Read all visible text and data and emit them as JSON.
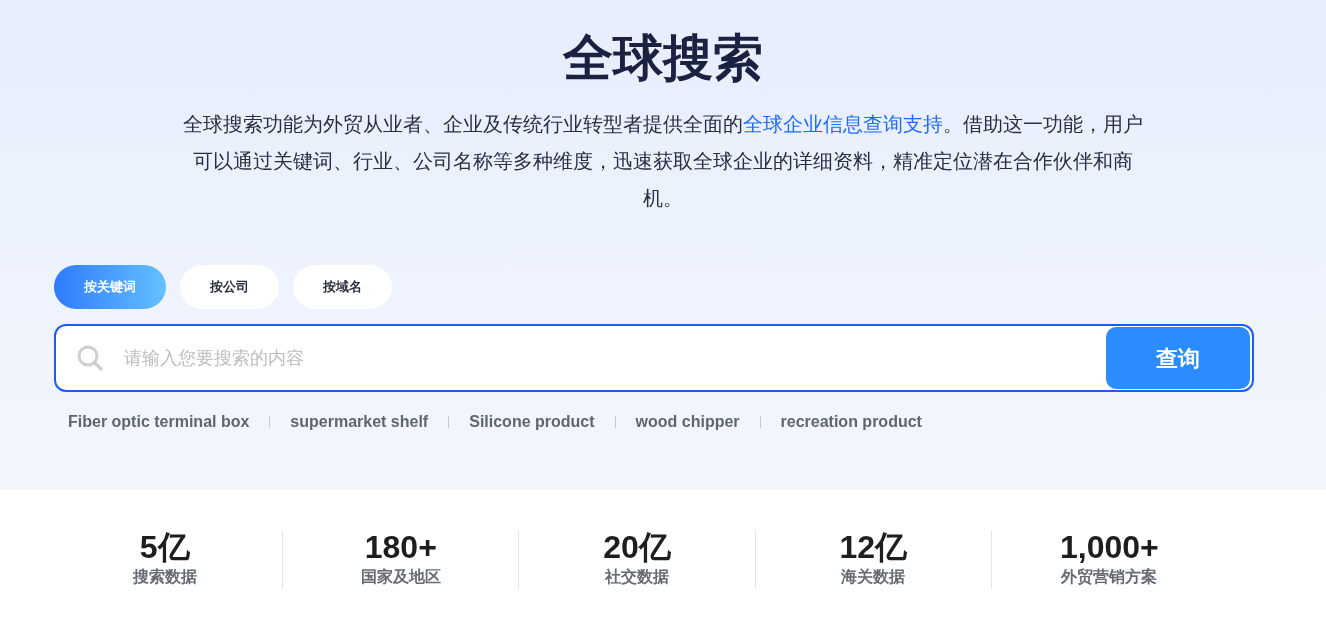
{
  "title": "全球搜索",
  "description": {
    "before": "全球搜索功能为外贸从业者、企业及传统行业转型者提供全面的",
    "link": "全球企业信息查询支持",
    "after": "。借助这一功能，用户可以通过关键词、行业、公司名称等多种维度，迅速获取全球企业的详细资料，精准定位潜在合作伙伴和商机。"
  },
  "tabs": [
    {
      "label": "按关键词",
      "selected": true
    },
    {
      "label": "按公司",
      "selected": false
    },
    {
      "label": "按域名",
      "selected": false
    }
  ],
  "search": {
    "placeholder": "请输入您要搜索的内容",
    "button": "查询"
  },
  "suggestions": [
    "Fiber optic terminal box",
    "supermarket shelf",
    "Silicone product",
    "wood chipper",
    "recreation product"
  ],
  "stats": [
    {
      "value": "5亿",
      "label": "搜索数据"
    },
    {
      "value": "180+",
      "label": "国家及地区"
    },
    {
      "value": "20亿",
      "label": "社交数据"
    },
    {
      "value": "12亿",
      "label": "海关数据"
    },
    {
      "value": "1,000+",
      "label": "外贸营销方案"
    }
  ]
}
